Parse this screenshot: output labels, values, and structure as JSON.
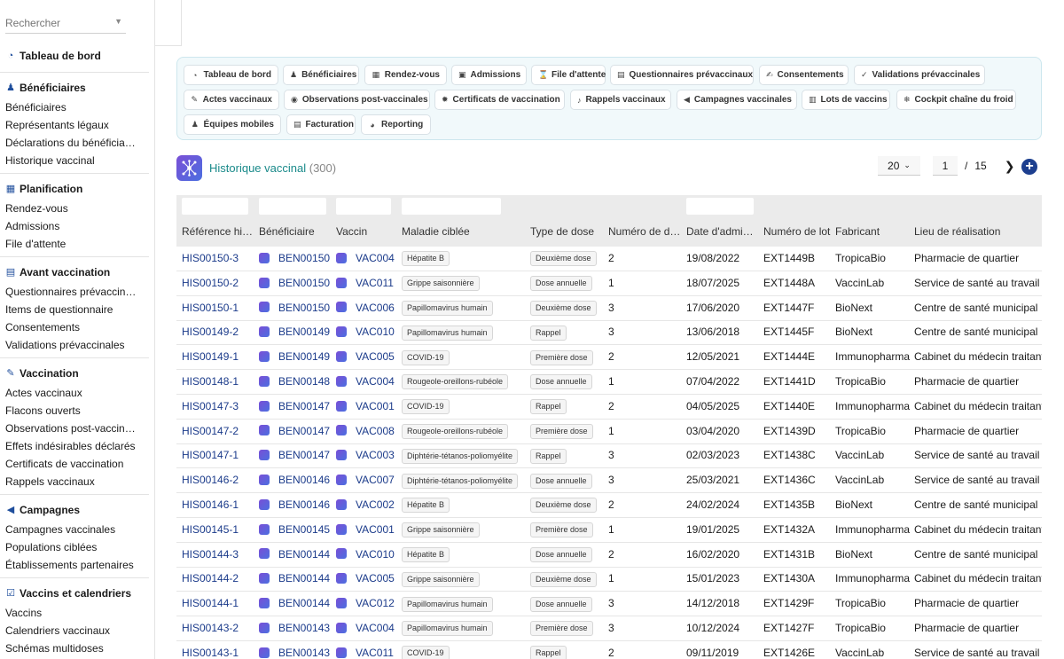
{
  "sidebar": {
    "search_placeholder": "Rechercher",
    "dashboard": "Tableau de bord",
    "groups": [
      {
        "title": "Bénéficiaires",
        "items": [
          "Bénéficiaires",
          "Représentants légaux",
          "Déclarations du bénéficia…",
          "Historique vaccinal"
        ]
      },
      {
        "title": "Planification",
        "items": [
          "Rendez-vous",
          "Admissions",
          "File d'attente"
        ]
      },
      {
        "title": "Avant vaccination",
        "items": [
          "Questionnaires prévaccin…",
          "Items de questionnaire",
          "Consentements",
          "Validations prévaccinales"
        ]
      },
      {
        "title": "Vaccination",
        "items": [
          "Actes vaccinaux",
          "Flacons ouverts",
          "Observations post-vaccin…",
          "Effets indésirables déclarés",
          "Certificats de vaccination",
          "Rappels vaccinaux"
        ]
      },
      {
        "title": "Campagnes",
        "items": [
          "Campagnes vaccinales",
          "Populations ciblées",
          "Établissements partenaires"
        ]
      },
      {
        "title": "Vaccins et calendriers",
        "items": [
          "Vaccins",
          "Calendriers vaccinaux",
          "Schémas multidoses"
        ]
      }
    ]
  },
  "nav_buttons": [
    {
      "label": "Tableau de bord",
      "icon": "gauge-icon"
    },
    {
      "label": "Bénéficiaires",
      "icon": "people-icon"
    },
    {
      "label": "Rendez-vous",
      "icon": "calendar-icon"
    },
    {
      "label": "Admissions",
      "icon": "clipboard-check-icon"
    },
    {
      "label": "File d'attente",
      "icon": "hourglass-icon"
    },
    {
      "label": "Questionnaires prévaccinaux",
      "icon": "clipboard-icon"
    },
    {
      "label": "Consentements",
      "icon": "signature-icon"
    },
    {
      "label": "Validations prévaccinales",
      "icon": "user-check-icon"
    },
    {
      "label": "Actes vaccinaux",
      "icon": "syringe-icon"
    },
    {
      "label": "Observations post-vaccinales",
      "icon": "eye-icon"
    },
    {
      "label": "Certificats de vaccination",
      "icon": "certificate-icon"
    },
    {
      "label": "Rappels vaccinaux",
      "icon": "bell-icon"
    },
    {
      "label": "Campagnes vaccinales",
      "icon": "megaphone-icon"
    },
    {
      "label": "Lots de vaccins",
      "icon": "barcode-icon"
    },
    {
      "label": "Cockpit chaîne du froid",
      "icon": "snowflake-icon"
    },
    {
      "label": "Équipes mobiles",
      "icon": "team-icon"
    },
    {
      "label": "Facturation",
      "icon": "invoice-icon"
    },
    {
      "label": "Reporting",
      "icon": "pie-chart-icon"
    }
  ],
  "page": {
    "title": "Historique vaccinal",
    "count": "(300)"
  },
  "pager": {
    "page_size": "20",
    "current_page": "1",
    "separator": "/",
    "total_pages": "15"
  },
  "table": {
    "columns": [
      "Référence hi…",
      "Bénéficiaire",
      "Vaccin",
      "Maladie ciblée",
      "Type de dose",
      "Numéro de d…",
      "Date d'admi…",
      "Numéro de lot",
      "Fabricant",
      "Lieu de réalisation"
    ],
    "rows": [
      [
        "HIS00150-3",
        "BEN00150",
        "VAC004",
        "Hépatite B",
        "Deuxième dose",
        "2",
        "19/08/2022",
        "EXT1449B",
        "TropicaBio",
        "Pharmacie de quartier"
      ],
      [
        "HIS00150-2",
        "BEN00150",
        "VAC011",
        "Grippe saisonnière",
        "Dose annuelle",
        "1",
        "18/07/2025",
        "EXT1448A",
        "VaccinLab",
        "Service de santé au travail"
      ],
      [
        "HIS00150-1",
        "BEN00150",
        "VAC006",
        "Papillomavirus humain",
        "Deuxième dose",
        "3",
        "17/06/2020",
        "EXT1447F",
        "BioNext",
        "Centre de santé municipal"
      ],
      [
        "HIS00149-2",
        "BEN00149",
        "VAC010",
        "Papillomavirus humain",
        "Rappel",
        "3",
        "13/06/2018",
        "EXT1445F",
        "BioNext",
        "Centre de santé municipal"
      ],
      [
        "HIS00149-1",
        "BEN00149",
        "VAC005",
        "COVID-19",
        "Première dose",
        "2",
        "12/05/2021",
        "EXT1444E",
        "Immunopharma",
        "Cabinet du médecin traitant"
      ],
      [
        "HIS00148-1",
        "BEN00148",
        "VAC004",
        "Rougeole-oreillons-rubéole",
        "Dose annuelle",
        "1",
        "07/04/2022",
        "EXT1441D",
        "TropicaBio",
        "Pharmacie de quartier"
      ],
      [
        "HIS00147-3",
        "BEN00147",
        "VAC001",
        "COVID-19",
        "Rappel",
        "2",
        "04/05/2025",
        "EXT1440E",
        "Immunopharma",
        "Cabinet du médecin traitant"
      ],
      [
        "HIS00147-2",
        "BEN00147",
        "VAC008",
        "Rougeole-oreillons-rubéole",
        "Première dose",
        "1",
        "03/04/2020",
        "EXT1439D",
        "TropicaBio",
        "Pharmacie de quartier"
      ],
      [
        "HIS00147-1",
        "BEN00147",
        "VAC003",
        "Diphtérie-tétanos-poliomyélite",
        "Rappel",
        "3",
        "02/03/2023",
        "EXT1438C",
        "VaccinLab",
        "Service de santé au travail"
      ],
      [
        "HIS00146-2",
        "BEN00146",
        "VAC007",
        "Diphtérie-tétanos-poliomyélite",
        "Dose annuelle",
        "3",
        "25/03/2021",
        "EXT1436C",
        "VaccinLab",
        "Service de santé au travail"
      ],
      [
        "HIS00146-1",
        "BEN00146",
        "VAC002",
        "Hépatite B",
        "Deuxième dose",
        "2",
        "24/02/2024",
        "EXT1435B",
        "BioNext",
        "Centre de santé municipal"
      ],
      [
        "HIS00145-1",
        "BEN00145",
        "VAC001",
        "Grippe saisonnière",
        "Première dose",
        "1",
        "19/01/2025",
        "EXT1432A",
        "Immunopharma",
        "Cabinet du médecin traitant"
      ],
      [
        "HIS00144-3",
        "BEN00144",
        "VAC010",
        "Hépatite B",
        "Dose annuelle",
        "2",
        "16/02/2020",
        "EXT1431B",
        "BioNext",
        "Centre de santé municipal"
      ],
      [
        "HIS00144-2",
        "BEN00144",
        "VAC005",
        "Grippe saisonnière",
        "Deuxième dose",
        "1",
        "15/01/2023",
        "EXT1430A",
        "Immunopharma",
        "Cabinet du médecin traitant"
      ],
      [
        "HIS00144-1",
        "BEN00144",
        "VAC012",
        "Papillomavirus humain",
        "Dose annuelle",
        "3",
        "14/12/2018",
        "EXT1429F",
        "TropicaBio",
        "Pharmacie de quartier"
      ],
      [
        "HIS00143-2",
        "BEN00143",
        "VAC004",
        "Papillomavirus humain",
        "Première dose",
        "3",
        "10/12/2024",
        "EXT1427F",
        "TropicaBio",
        "Pharmacie de quartier"
      ],
      [
        "HIS00143-1",
        "BEN00143",
        "VAC011",
        "COVID-19",
        "Rappel",
        "2",
        "09/11/2019",
        "EXT1426E",
        "VaccinLab",
        "Service de santé au travail"
      ]
    ]
  },
  "colors": {
    "accent": "#1a8a8a",
    "link": "#1a3a8a",
    "nav_icon": "#1f4e9c",
    "add_button": "#1d3f8f"
  }
}
